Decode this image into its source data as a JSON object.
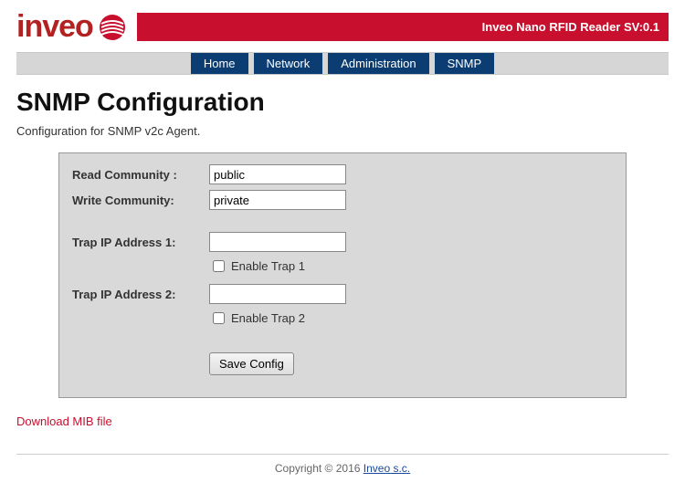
{
  "header": {
    "logo_text": "inveo",
    "banner": "Inveo Nano RFID Reader SV:0.1"
  },
  "nav": {
    "items": [
      {
        "label": "Home"
      },
      {
        "label": "Network"
      },
      {
        "label": "Administration"
      },
      {
        "label": "SNMP"
      }
    ]
  },
  "page": {
    "title": "SNMP Configuration",
    "subtitle": "Configuration for SNMP v2c Agent."
  },
  "form": {
    "read_community_label": "Read Community :",
    "read_community_value": "public",
    "write_community_label": "Write Community:",
    "write_community_value": "private",
    "trap1_label": "Trap IP Address 1:",
    "trap1_value": "",
    "enable_trap1_label": "Enable Trap 1",
    "trap2_label": "Trap IP Address 2:",
    "trap2_value": "",
    "enable_trap2_label": "Enable Trap 2",
    "save_label": "Save Config"
  },
  "links": {
    "download_mib": "Download MIB file"
  },
  "footer": {
    "copyright": "Copyright © 2016 ",
    "link_text": "Inveo s.c."
  }
}
